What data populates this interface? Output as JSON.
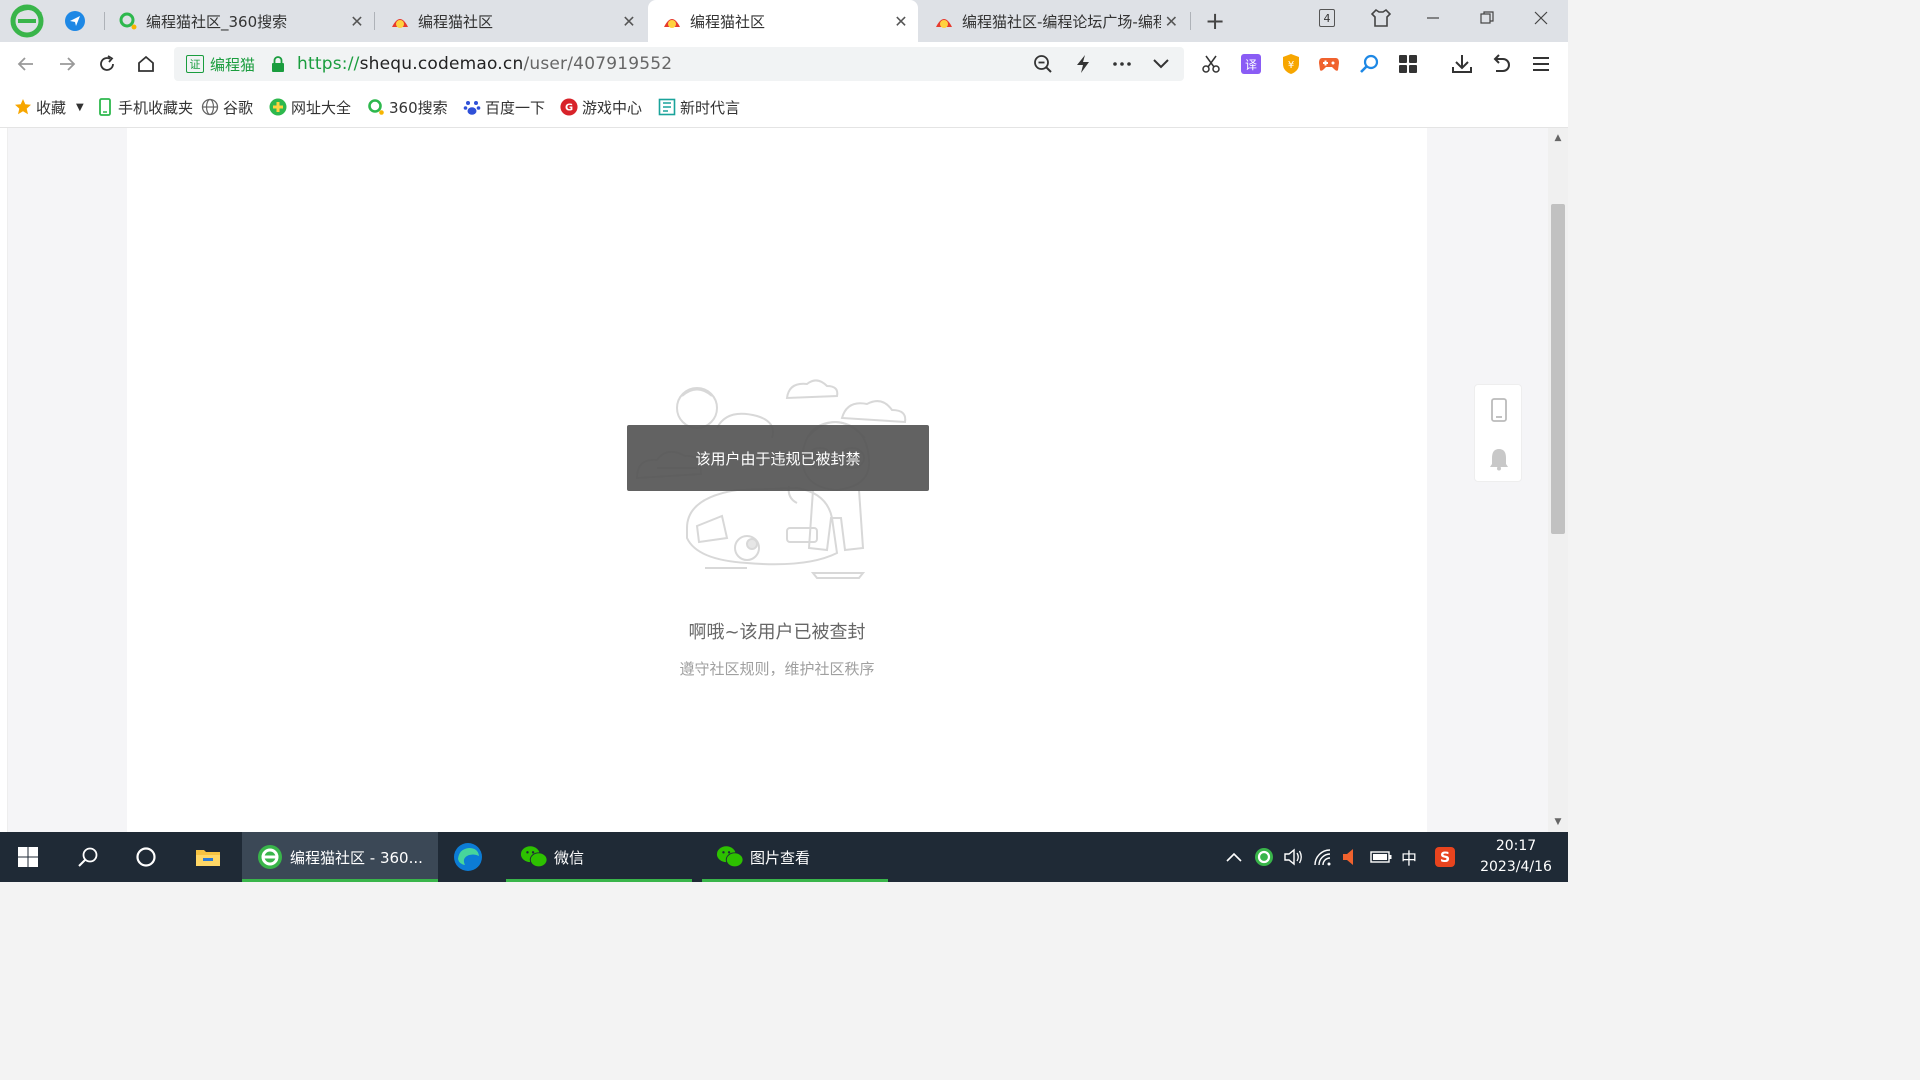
{
  "browser": {
    "tabs": [
      {
        "title": "编程猫社区_360搜索",
        "active": false
      },
      {
        "title": "编程猫社区",
        "active": false
      },
      {
        "title": "编程猫社区",
        "active": true
      },
      {
        "title": "编程猫社区-编程论坛广场-编程",
        "active": false
      }
    ],
    "tab_count": "4",
    "cert_label": "编程猫",
    "cert_mark": "证",
    "url": {
      "scheme": "https://",
      "host": "shequ.codemao.cn",
      "path": "/user/407919552"
    },
    "translate_mark": "译",
    "bookmarks": [
      {
        "label": "收藏"
      },
      {
        "label": "手机收藏夹"
      },
      {
        "label": "谷歌"
      },
      {
        "label": "网址大全"
      },
      {
        "label": "360搜索"
      },
      {
        "label": "百度一下"
      },
      {
        "label": "游戏中心"
      },
      {
        "label": "新时代言"
      }
    ]
  },
  "page": {
    "toast": "该用户由于违规已被封禁",
    "ban_title": "啊哦~该用户已被查封",
    "ban_subtitle": "遵守社区规则，维护社区秩序"
  },
  "taskbar": {
    "apps": [
      {
        "label": "编程猫社区 - 360..."
      },
      {
        "label": "微信"
      },
      {
        "label": "图片查看"
      }
    ],
    "ime": "中",
    "time": "20:17",
    "date": "2023/4/16"
  },
  "colors": {
    "accent_green": "#1a9d3e",
    "taskbar_bg": "#1f2a36",
    "toast_bg": "#555555"
  }
}
